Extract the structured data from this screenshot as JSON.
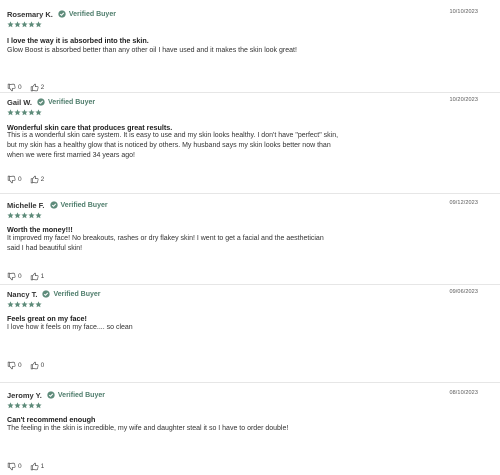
{
  "verified_label": "Verified Buyer",
  "star_color": "#5f8c7b",
  "reviews": [
    {
      "author": "Rosemary K.",
      "date": "10/10/2023",
      "rating": 5,
      "title": "I love the way it is absorbed into the skin.",
      "body": "Glow Boost is absorbed better than any other oil I have used and it makes the skin look great!",
      "thumbs_down": "0",
      "thumbs_up": "2"
    },
    {
      "author": "Gail W.",
      "date": "10/20/2023",
      "rating": 5,
      "title": "Wonderful skin care that produces great results.",
      "body": "This is a wonderful skin care system. It is easy to use and my skin looks healthy. I don't have \"perfect\" skin, but my skin has a healthy glow that is noticed by others. My husband says my skin looks better now than when we were first married 34 years ago!",
      "thumbs_down": "0",
      "thumbs_up": "2"
    },
    {
      "author": "Michelle F.",
      "date": "09/12/2023",
      "rating": 5,
      "title": "Worth the money!!!",
      "body": "It improved my face! No breakouts, rashes or dry flakey skin! I went to get a facial and the aesthetician said I had beautiful skin!",
      "thumbs_down": "0",
      "thumbs_up": "1"
    },
    {
      "author": "Nancy T.",
      "date": "09/06/2023",
      "rating": 5,
      "title": "Feels great on my face!",
      "body": "I love how it feels on my face.... so clean",
      "thumbs_down": "0",
      "thumbs_up": "0"
    },
    {
      "author": "Jeromy Y.",
      "date": "08/10/2023",
      "rating": 5,
      "title": "Can't recommend enough",
      "body": "The feeling in the skin is incredible, my wife and daughter steal it so I have to order double!",
      "thumbs_down": "0",
      "thumbs_up": "1"
    }
  ]
}
